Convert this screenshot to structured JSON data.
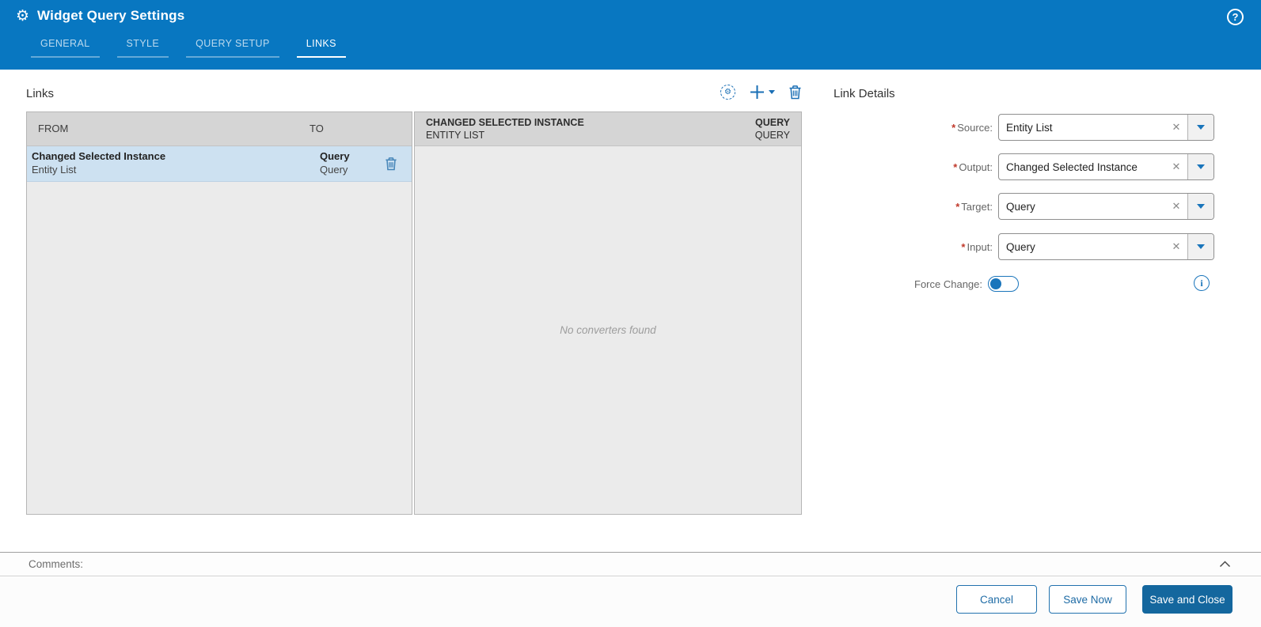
{
  "header": {
    "title": "Widget Query Settings",
    "tabs": [
      {
        "label": "GENERAL",
        "active": false
      },
      {
        "label": "STYLE",
        "active": false
      },
      {
        "label": "QUERY SETUP",
        "active": false
      },
      {
        "label": "LINKS",
        "active": true
      }
    ]
  },
  "links_panel": {
    "title": "Links",
    "table": {
      "columns": {
        "from": "FROM",
        "to": "TO"
      },
      "rows": [
        {
          "from_primary": "Changed Selected Instance",
          "from_secondary": "Entity List",
          "to_primary": "Query",
          "to_secondary": "Query",
          "selected": true
        }
      ]
    }
  },
  "converters_panel": {
    "header": {
      "from_primary": "CHANGED SELECTED INSTANCE",
      "from_secondary": "ENTITY LIST",
      "to_primary": "QUERY",
      "to_secondary": "QUERY"
    },
    "empty_message": "No converters found"
  },
  "link_details": {
    "title": "Link Details",
    "fields": [
      {
        "label": "Source:",
        "value": "Entity List",
        "required": true
      },
      {
        "label": "Output:",
        "value": "Changed Selected Instance",
        "required": true
      },
      {
        "label": "Target:",
        "value": "Query",
        "required": true
      },
      {
        "label": "Input:",
        "value": "Query",
        "required": true
      }
    ],
    "force_change": {
      "label": "Force Change:",
      "enabled": false
    }
  },
  "comments": {
    "label": "Comments:"
  },
  "footer": {
    "cancel_label": "Cancel",
    "save_now_label": "Save Now",
    "save_and_close_label": "Save and Close"
  },
  "icons": {
    "gear": "⚙",
    "help": "?",
    "info": "i",
    "clear": "✕",
    "required": "*"
  },
  "colors": {
    "header_blue": "#0877c1",
    "primary_button": "#14679e",
    "accent_blue": "#1a75bb",
    "selected_row": "#cde1f1",
    "table_header": "#d5d5d5",
    "table_body": "#ebebeb"
  }
}
